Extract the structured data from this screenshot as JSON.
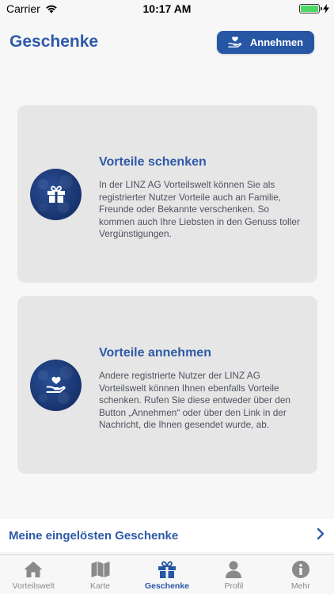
{
  "status_bar": {
    "carrier": "Carrier",
    "time": "10:17 AM"
  },
  "header": {
    "title": "Geschenke",
    "accept_button_label": "Annehmen"
  },
  "cards": [
    {
      "title": "Vorteile schenken",
      "body": "In der LINZ AG Vorteilswelt können Sie als registrierter Nutzer Vorteile auch an Familie, Freunde oder Bekannte verschenken. So kommen auch Ihre Liebsten in den Genuss toller Vergünstigungen.",
      "icon": "gift-icon"
    },
    {
      "title": "Vorteile annehmen",
      "body": "Andere registrierte Nutzer der LINZ AG Vorteilswelt können Ihnen ebenfalls Vorteile schenken. Rufen Sie diese entweder über den Button „Annehmen“ oder über den Link in der Nachricht, die Ihnen gesendet wurde, ab.",
      "icon": "heart-hand-icon"
    }
  ],
  "redeemed_link": {
    "label": "Meine eingelösten Geschenke"
  },
  "tab_bar": {
    "tabs": [
      {
        "label": "Vorteilswelt",
        "icon": "home-icon",
        "active": false
      },
      {
        "label": "Karte",
        "icon": "map-icon",
        "active": false
      },
      {
        "label": "Geschenke",
        "icon": "gift-icon",
        "active": true
      },
      {
        "label": "Profil",
        "icon": "person-icon",
        "active": false
      },
      {
        "label": "Mehr",
        "icon": "info-icon",
        "active": false
      }
    ]
  },
  "colors": {
    "accent": "#2756a4",
    "title_blue": "#2e5aa8",
    "card_bg": "#e6e6e6",
    "icon_circle": "#17336e",
    "tab_inactive": "#8a8a8a"
  }
}
